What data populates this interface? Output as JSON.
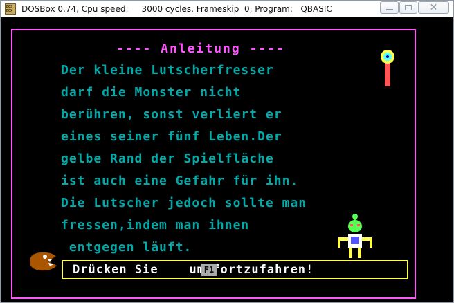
{
  "window": {
    "title": "DOSBox 0.74, Cpu speed:     3000 cycles, Frameskip  0, Program:   QBASIC",
    "close_label": "✕"
  },
  "screen": {
    "heading": "---- Anleitung ----",
    "instructions": "Der kleine Lutscherfresser\ndarf die Monster nicht\nberühren, sonst verliert er\neines seiner fünf Leben.Der\ngelbe Rand der Spielfläche\nist auch eine Gefahr für ihn.\nDie Lutscher jedoch sollte man\nfressen,indem man ihnen\n entgegen läuft.",
    "prompt": "Drücken Sie    um fortzufahren!",
    "key_label": "F1",
    "colors": {
      "background": "#000000",
      "frame": "#ff55ff",
      "text": "#00aaaa",
      "prompt_border": "#ffff55",
      "prompt_text": "#ffffff"
    }
  },
  "icons": [
    "dosbox-icon",
    "minimize-icon",
    "maximize-icon",
    "close-icon",
    "lollipop-icon",
    "monster-sprite",
    "chomper-sprite"
  ]
}
